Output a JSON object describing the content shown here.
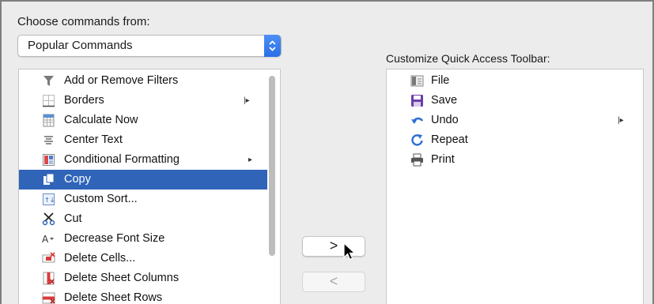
{
  "commands_from": {
    "label": "Choose commands from:",
    "selected": "Popular Commands"
  },
  "commands": [
    {
      "label": "Add or Remove Filters",
      "icon": "filter-icon",
      "submenu": false,
      "split": false,
      "selected": false
    },
    {
      "label": "Borders",
      "icon": "borders-icon",
      "submenu": false,
      "split": true,
      "selected": false
    },
    {
      "label": "Calculate Now",
      "icon": "calculate-icon",
      "submenu": false,
      "split": false,
      "selected": false
    },
    {
      "label": "Center Text",
      "icon": "center-text-icon",
      "submenu": false,
      "split": false,
      "selected": false
    },
    {
      "label": "Conditional Formatting",
      "icon": "conditional-formatting-icon",
      "submenu": true,
      "split": false,
      "selected": false
    },
    {
      "label": "Copy",
      "icon": "copy-icon",
      "submenu": false,
      "split": false,
      "selected": true
    },
    {
      "label": "Custom Sort...",
      "icon": "custom-sort-icon",
      "submenu": false,
      "split": false,
      "selected": false
    },
    {
      "label": "Cut",
      "icon": "scissors-icon",
      "submenu": false,
      "split": false,
      "selected": false
    },
    {
      "label": "Decrease Font Size",
      "icon": "decrease-font-icon",
      "submenu": false,
      "split": false,
      "selected": false
    },
    {
      "label": "Delete Cells...",
      "icon": "delete-cells-icon",
      "submenu": false,
      "split": false,
      "selected": false
    },
    {
      "label": "Delete Sheet Columns",
      "icon": "delete-columns-icon",
      "submenu": false,
      "split": false,
      "selected": false
    },
    {
      "label": "Delete Sheet Rows",
      "icon": "delete-rows-icon",
      "submenu": false,
      "split": false,
      "selected": false
    }
  ],
  "toolbar": {
    "label": "Customize Quick Access Toolbar:",
    "items": [
      {
        "label": "File",
        "icon": "file-icon",
        "split": false
      },
      {
        "label": "Save",
        "icon": "save-icon",
        "split": false
      },
      {
        "label": "Undo",
        "icon": "undo-icon",
        "split": true
      },
      {
        "label": "Repeat",
        "icon": "repeat-icon",
        "split": false
      },
      {
        "label": "Print",
        "icon": "print-icon",
        "split": false
      }
    ]
  },
  "buttons": {
    "add": ">",
    "remove": "<"
  },
  "colors": {
    "selection": "#2f64b8",
    "stepper": "#2a6fe6"
  }
}
